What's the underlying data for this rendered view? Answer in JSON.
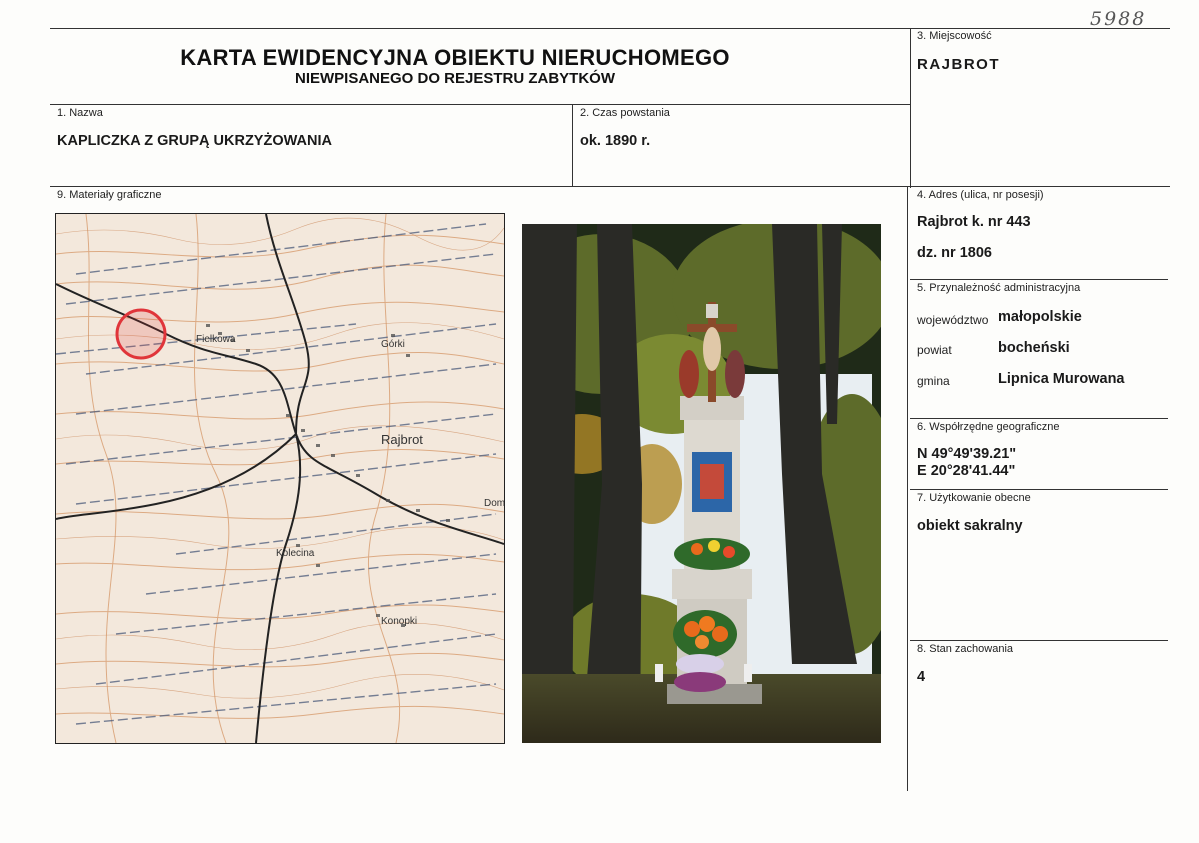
{
  "handwritten_number": "5988",
  "header": {
    "title": "KARTA EWIDENCYJNA OBIEKTU NIERUCHOMEGO",
    "subtitle": "NIEWPISANEGO DO REJESTRU ZABYTKÓW"
  },
  "fields": {
    "name": {
      "label": "1. Nazwa",
      "value": "KAPLICZKA Z GRUPĄ UKRZYŻOWANIA"
    },
    "time": {
      "label": "2. Czas powstania",
      "value": "ok. 1890 r."
    },
    "place": {
      "label": "3. Miejscowość",
      "value": "RAJBROT"
    },
    "address": {
      "label": "4. Adres (ulica, nr posesji)",
      "line1": "Rajbrot k. nr 443",
      "line2": "dz. nr 1806"
    },
    "admin": {
      "label": "5. Przynależność administracyjna",
      "voivodeship_label": "województwo",
      "voivodeship": "małopolskie",
      "county_label": "powiat",
      "county": "bocheński",
      "commune_label": "gmina",
      "commune": "Lipnica Murowana"
    },
    "coords": {
      "label": "6. Współrzędne geograficzne",
      "lat": "N 49°49'39.21\"",
      "lon": "E 20°28'41.44\""
    },
    "usage": {
      "label": "7. Użytkowanie obecne",
      "value": "obiekt sakralny"
    },
    "condition": {
      "label": "8. Stan zachowania",
      "value": "4"
    },
    "graphics": {
      "label": "9. Materiały graficzne"
    }
  },
  "map": {
    "places": [
      "Fielkowa",
      "Górki",
      "Rajbrot",
      "Kolecina",
      "Konopki",
      "Dom"
    ],
    "marker_color": "#e0353a",
    "contour_color": "#d9a074"
  },
  "photo": {
    "subject": "roadside shrine with crucifixion group",
    "colors": {
      "trees": "#2a2a26",
      "foliage": "#5d6b2a",
      "sky": "#e8eef2",
      "flowers": "#e86a1c"
    }
  }
}
